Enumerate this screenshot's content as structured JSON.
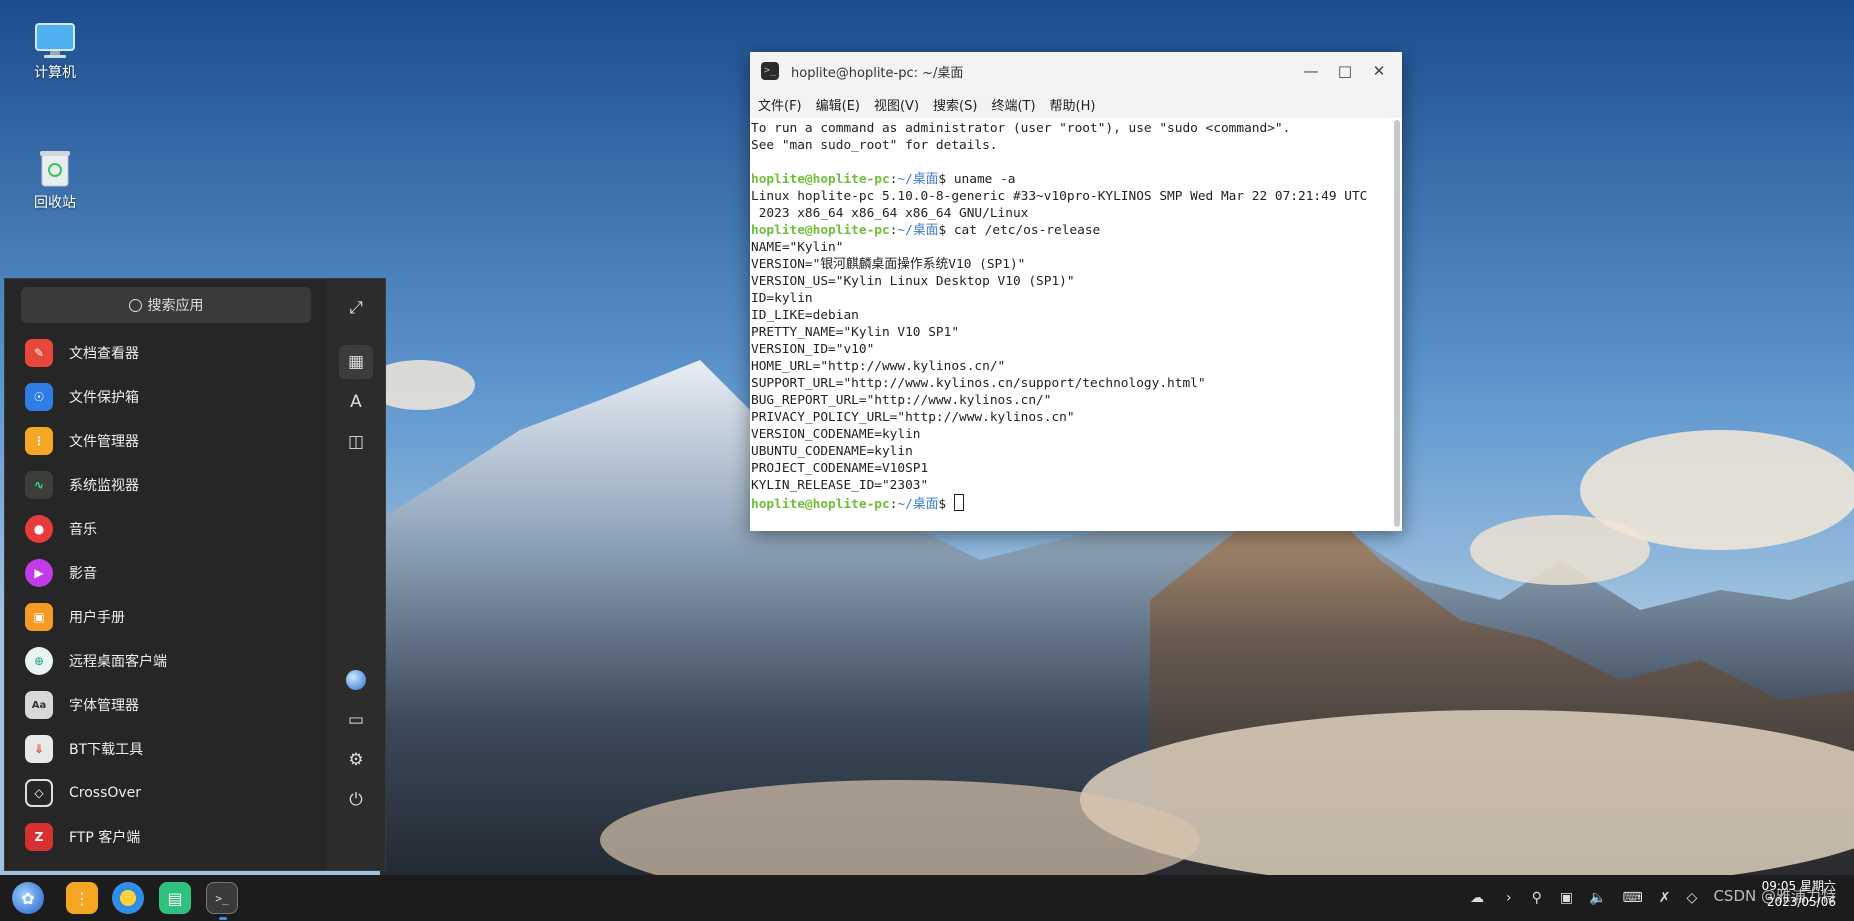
{
  "desktop": {
    "icons": [
      {
        "label": "计算机"
      },
      {
        "label": "回收站"
      }
    ]
  },
  "terminal": {
    "title": "hoplite@hoplite-pc: ~/桌面",
    "menu": [
      "文件(F)",
      "编辑(E)",
      "视图(V)",
      "搜索(S)",
      "终端(T)",
      "帮助(H)"
    ],
    "user": "hoplite@hoplite-pc",
    "cwd": "~/桌面",
    "intro": [
      "To run a command as administrator (user \"root\"), use \"sudo <command>\".",
      "See \"man sudo_root\" for details."
    ],
    "cmd1": "uname -a",
    "uname_out": [
      "Linux hoplite-pc 5.10.0-8-generic #33~v10pro-KYLINOS SMP Wed Mar 22 07:21:49 UTC",
      " 2023 x86_64 x86_64 x86_64 GNU/Linux"
    ],
    "cmd2": "cat /etc/os-release",
    "os_release": [
      "NAME=\"Kylin\"",
      "VERSION=\"银河麒麟桌面操作系统V10 (SP1)\"",
      "VERSION_US=\"Kylin Linux Desktop V10 (SP1)\"",
      "ID=kylin",
      "ID_LIKE=debian",
      "PRETTY_NAME=\"Kylin V10 SP1\"",
      "VERSION_ID=\"v10\"",
      "HOME_URL=\"http://www.kylinos.cn/\"",
      "SUPPORT_URL=\"http://www.kylinos.cn/support/technology.html\"",
      "BUG_REPORT_URL=\"http://www.kylinos.cn/\"",
      "PRIVACY_POLICY_URL=\"http://www.kylinos.cn\"",
      "VERSION_CODENAME=kylin",
      "UBUNTU_CODENAME=kylin",
      "PROJECT_CODENAME=V10SP1",
      "KYLIN_RELEASE_ID=\"2303\""
    ]
  },
  "startmenu": {
    "search_placeholder": "搜索应用",
    "apps": [
      {
        "label": "文档查看器",
        "color": "#e8483b",
        "icon": "document-viewer-icon"
      },
      {
        "label": "文件保护箱",
        "color": "#2f7ee8",
        "icon": "file-safe-icon"
      },
      {
        "label": "文件管理器",
        "color": "#f5a623",
        "icon": "file-manager-icon"
      },
      {
        "label": "系统监视器",
        "color": "#3a3f3a",
        "icon": "system-monitor-icon"
      },
      {
        "label": "音乐",
        "color": "#e83b3b",
        "icon": "music-icon"
      },
      {
        "label": "影音",
        "color": "#c23be8",
        "icon": "video-icon"
      },
      {
        "label": "用户手册",
        "color": "#f59a23",
        "icon": "user-manual-icon"
      },
      {
        "label": "远程桌面客户端",
        "color": "#3bb0a0",
        "icon": "remote-desktop-icon"
      },
      {
        "label": "字体管理器",
        "color": "#8a8a8a",
        "icon": "font-manager-icon"
      },
      {
        "label": "BT下载工具",
        "color": "#d84a4a",
        "icon": "bt-download-icon"
      },
      {
        "label": "CrossOver",
        "color": "#262626",
        "icon": "crossover-icon"
      },
      {
        "label": "FTP 客户端",
        "color": "#d63030",
        "icon": "ftp-client-icon"
      }
    ]
  },
  "taskbar": {
    "time_line": "09:05 星期六",
    "date_line": "2023/05/06"
  },
  "watermark": "CSDN @雅浦力特"
}
